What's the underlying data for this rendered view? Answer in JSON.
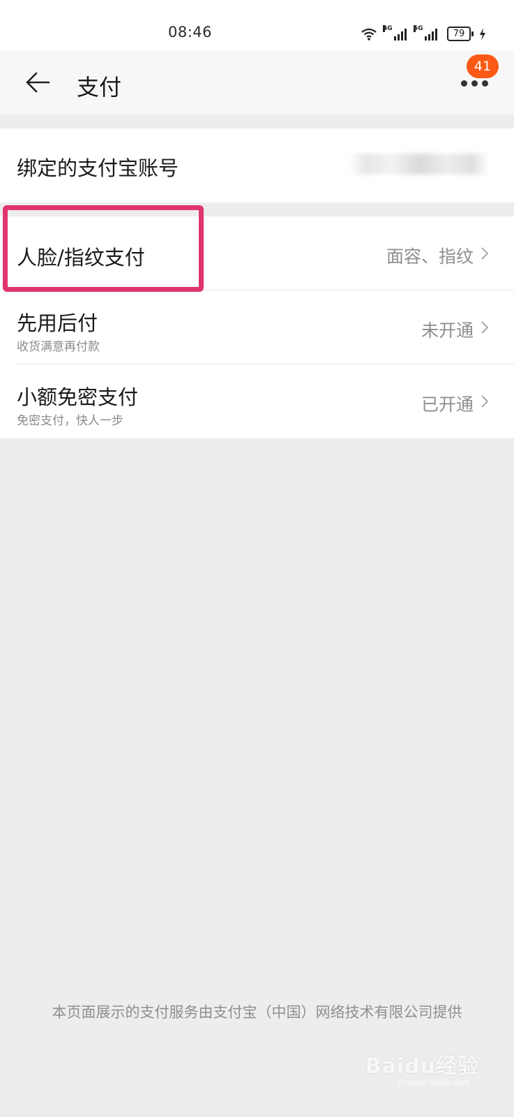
{
  "status_bar": {
    "time": "08:46",
    "network_left": "4G",
    "network_right": "5G",
    "battery": "79"
  },
  "nav": {
    "title": "支付",
    "badge_count": "41"
  },
  "account": {
    "label": "绑定的支付宝账号"
  },
  "settings": [
    {
      "title": "人脸/指纹支付",
      "subtitle": "",
      "value": "面容、指纹"
    },
    {
      "title": "先用后付",
      "subtitle": "收货满意再付款",
      "value": "未开通"
    },
    {
      "title": "小额免密支付",
      "subtitle": "免密支付，快人一步",
      "value": "已开通"
    }
  ],
  "footer": {
    "note": "本页面展示的支付服务由支付宝（中国）网络技术有限公司提供"
  },
  "watermark": {
    "brand": "Baidu经验",
    "url": "jingyan.baidu.com"
  },
  "colors": {
    "badge": "#fa5a16",
    "highlight": "#e0356e",
    "background": "#ededed"
  },
  "icons": [
    "back-arrow-icon",
    "more-icon",
    "chevron-right-icon",
    "wifi-icon",
    "signal-icon",
    "battery-icon",
    "charging-icon"
  ]
}
